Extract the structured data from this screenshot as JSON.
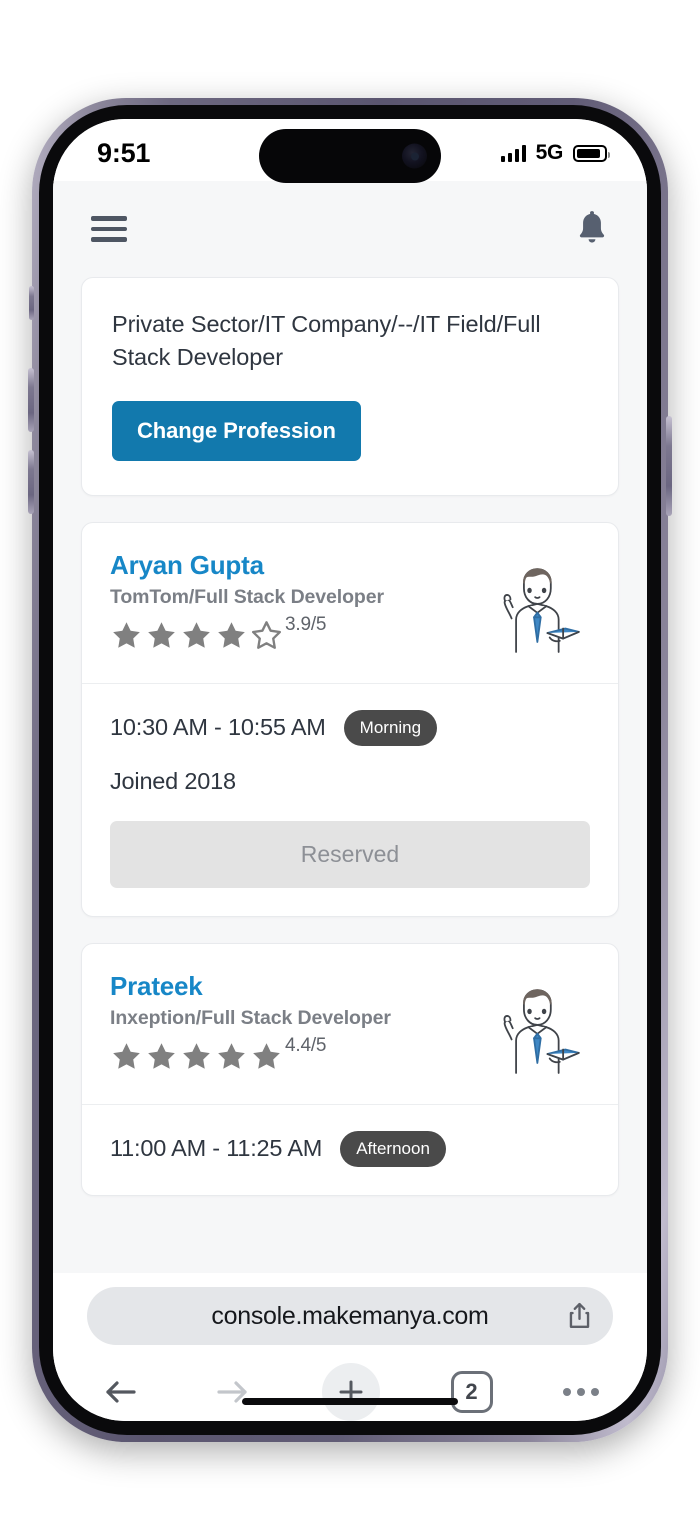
{
  "status_bar": {
    "time": "9:51",
    "network": "5G",
    "signal_icon": "signal-bars-icon",
    "battery_icon": "battery-icon"
  },
  "app_header": {
    "menu_icon": "hamburger-menu-icon",
    "notification_icon": "bell-icon"
  },
  "profession_card": {
    "path_text": "Private Sector/IT Company/--/IT Field/Full Stack Developer",
    "change_button": "Change Profession",
    "button_color": "#1279ad"
  },
  "mentors": [
    {
      "name": "Aryan Gupta",
      "company_role": "TomTom/Full Stack Developer",
      "rating_value": "3.9/5",
      "stars_filled": 4,
      "stars_total": 5,
      "avatar_icon": "mentor-illustration-icon",
      "slot_time": "10:30 AM - 10:55 AM",
      "slot_period": "Morning",
      "joined": "Joined 2018",
      "action_label": "Reserved",
      "action_disabled": true
    },
    {
      "name": "Prateek",
      "company_role": "Inxeption/Full Stack Developer",
      "rating_value": "4.4/5",
      "stars_filled": 5,
      "stars_total": 5,
      "avatar_icon": "mentor-illustration-icon",
      "slot_time": "11:00 AM - 11:25 AM",
      "slot_period": "Afternoon"
    }
  ],
  "browser": {
    "url": "console.makemanya.com",
    "share_icon": "share-icon",
    "back_icon": "arrow-left-icon",
    "forward_icon": "arrow-right-icon",
    "new_tab_icon": "plus-icon",
    "tab_count": "2",
    "more_icon": "ellipsis-icon"
  },
  "colors": {
    "accent_blue": "#1279ad",
    "name_blue": "#1787c7",
    "pill_dark": "#4a4a4a",
    "star_gray": "#808080",
    "page_bg": "#f6f7f8"
  }
}
